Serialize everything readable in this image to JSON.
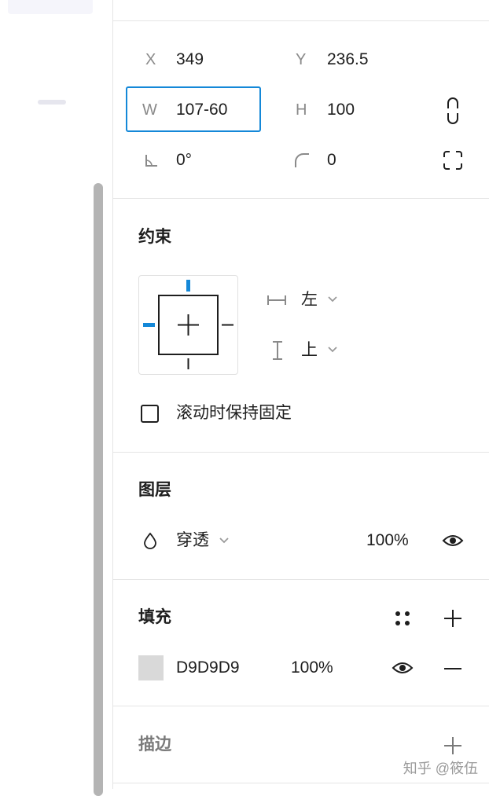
{
  "geometry": {
    "x_label": "X",
    "x_value": "349",
    "y_label": "Y",
    "y_value": "236.5",
    "w_label": "W",
    "w_value": "107-60",
    "h_label": "H",
    "h_value": "100",
    "rotation_value": "0°",
    "corner_radius_value": "0"
  },
  "constraints": {
    "title": "约束",
    "horizontal_value": "左",
    "vertical_value": "上",
    "fix_scroll_label": "滚动时保持固定"
  },
  "layer": {
    "title": "图层",
    "blend_mode": "穿透",
    "opacity": "100%"
  },
  "fill": {
    "title": "填充",
    "color_hex": "D9D9D9",
    "opacity": "100%",
    "swatch_color": "#d9d9d9"
  },
  "stroke": {
    "title": "描边"
  },
  "colors": {
    "accent": "#1488d8",
    "constraint_active": "#1488d8"
  },
  "watermark": "知乎 @筱伍"
}
